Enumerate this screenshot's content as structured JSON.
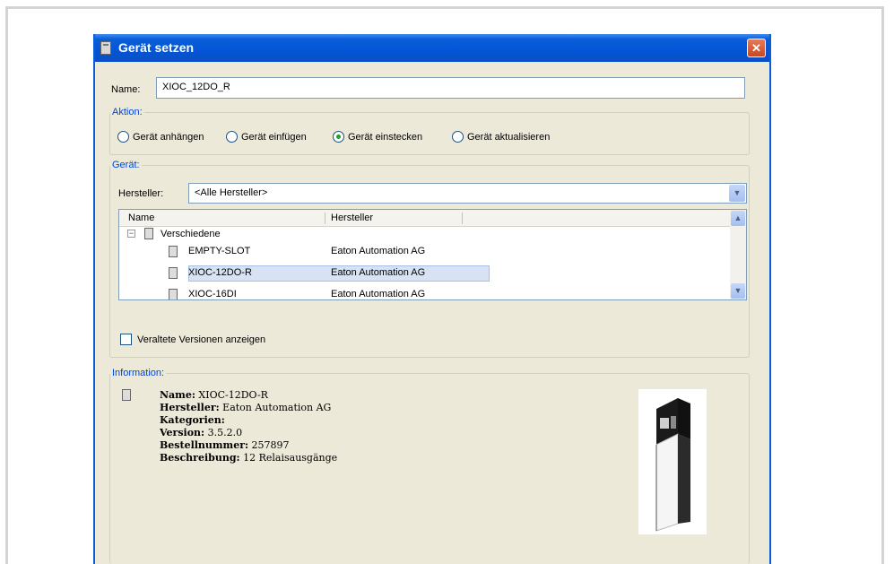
{
  "dialog": {
    "title": "Gerät setzen",
    "close": "✕"
  },
  "name": {
    "label": "Name:",
    "value": "XIOC_12DO_R"
  },
  "aktion": {
    "title": "Aktion:",
    "options": [
      {
        "label": "Gerät anhängen",
        "checked": false
      },
      {
        "label": "Gerät einfügen",
        "checked": false
      },
      {
        "label": "Gerät einstecken",
        "checked": true
      },
      {
        "label": "Gerät aktualisieren",
        "checked": false
      }
    ]
  },
  "geraet": {
    "title": "Gerät:",
    "hersteller_label": "Hersteller:",
    "hersteller_value": "<Alle Hersteller>",
    "columns": {
      "name": "Name",
      "hersteller": "Hersteller"
    },
    "tree": {
      "expander": "−",
      "group": "Verschiedene",
      "items": [
        {
          "name": "EMPTY-SLOT",
          "hersteller": "Eaton Automation AG"
        },
        {
          "name": "XIOC-12DO-R",
          "hersteller": "Eaton Automation AG",
          "selected": true
        },
        {
          "name": "XIOC-16DI",
          "hersteller": "Eaton Automation AG"
        }
      ]
    },
    "checkbox_label": "Veraltete Versionen anzeigen"
  },
  "information": {
    "title": "Information:",
    "lines": [
      {
        "key": "Name:",
        "value": " XIOC-12DO-R"
      },
      {
        "key": "Hersteller:",
        "value": " Eaton Automation AG"
      },
      {
        "key": "Kategorien:",
        "value": ""
      },
      {
        "key": "Version:",
        "value": " 3.5.2.0"
      },
      {
        "key": "Bestellnummer:",
        "value": " 257897"
      },
      {
        "key": "Beschreibung:",
        "value": " 12 Relaisausgänge"
      }
    ]
  },
  "icons": {
    "close": "close-icon",
    "dropdown": "chevron-down-icon",
    "device": "device-icon"
  }
}
